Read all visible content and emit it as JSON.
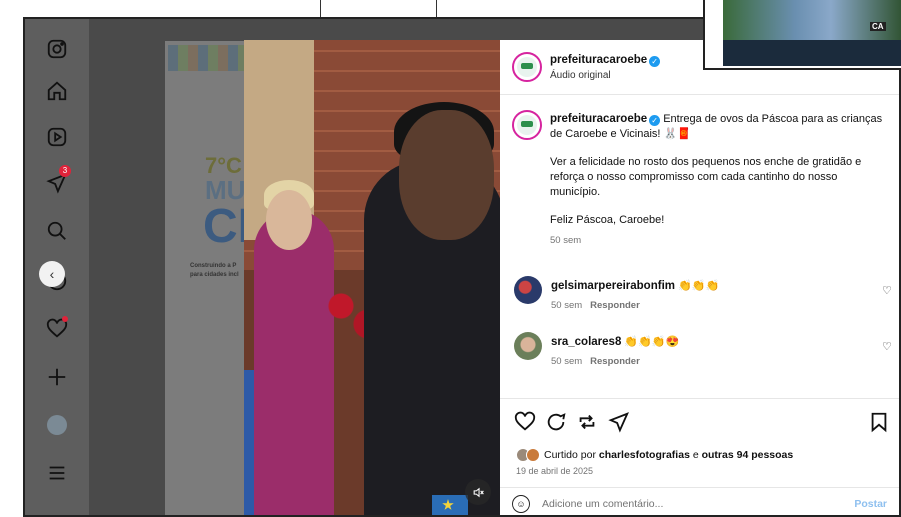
{
  "post": {
    "username": "prefeituracaroebe",
    "audio_label": "Áudio original",
    "caption_line1": "Entrega de ovos da Páscoa para as crianças de Caroebe e Vicinais! 🐰🧧",
    "caption_p2": "Ver a felicidade no rosto dos pequenos nos enche de gratidão e reforça o nosso compromisso com cada cantinho do nosso município.",
    "caption_p3": "Feliz Páscoa, Caroebe!",
    "caption_time": "50 sem"
  },
  "comments": [
    {
      "username": "gelsimarpereirabonfim",
      "text": "👏👏👏",
      "time": "50 sem",
      "reply": "Responder"
    },
    {
      "username": "sra_colares8",
      "text": "👏👏👏😍",
      "time": "50 sem",
      "reply": "Responder"
    }
  ],
  "likes": {
    "prefix": "Curtido por",
    "user": "charlesfotografias",
    "mid": "e",
    "others": "outras 94 pessoas"
  },
  "date": "19 de abril de 2025",
  "add_comment": {
    "placeholder": "Adicione um comentário...",
    "post_label": "Postar"
  },
  "sidebar": {
    "notification_count": "3"
  },
  "background_post": {
    "line1": "7°C",
    "line2": "MU",
    "line3": "CI",
    "line4": "Construindo a P",
    "line5": "para cidades incl"
  },
  "thumbnail_label": "CA",
  "colors": {
    "accent": "#0095f6",
    "verified": "#1d9bf0",
    "badge": "#e0233a"
  }
}
